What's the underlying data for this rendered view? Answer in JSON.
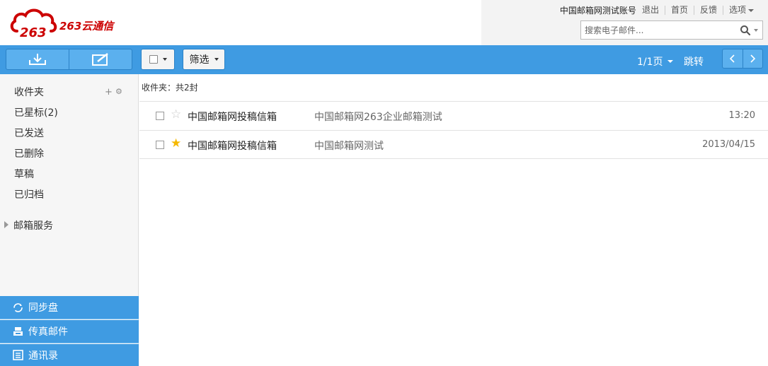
{
  "brand": {
    "logo_text": "263云通信"
  },
  "header": {
    "account": "中国邮箱网测试账号",
    "links": [
      "退出",
      "首页",
      "反馈",
      "选项"
    ],
    "search_placeholder": "搜索电子邮件..."
  },
  "toolbar": {
    "receive_icon": "download-tray-icon",
    "compose_icon": "compose-edit-icon",
    "filter_label": "筛选",
    "page_label": "1/1页",
    "jump_label": "跳转"
  },
  "sidebar": {
    "folders": [
      {
        "label": "收件夹"
      },
      {
        "label": "已星标(2)"
      },
      {
        "label": "已发送"
      },
      {
        "label": "已删除"
      },
      {
        "label": "草稿"
      },
      {
        "label": "已归档"
      }
    ],
    "mail_services": "邮箱服务",
    "bottom_nav": [
      {
        "label": "同步盘",
        "icon": "sync-icon"
      },
      {
        "label": "传真邮件",
        "icon": "fax-icon"
      },
      {
        "label": "通讯录",
        "icon": "contacts-icon"
      }
    ]
  },
  "main": {
    "folder_summary": "收件夹：共2封",
    "messages": [
      {
        "sender": "中国邮箱网投稿信箱",
        "subject": "中国邮箱网263企业邮箱测试",
        "time": "13:20",
        "starred": false
      },
      {
        "sender": "中国邮箱网投稿信箱",
        "subject": "中国邮箱网测试",
        "time": "2013/04/15",
        "starred": true
      }
    ]
  },
  "colors": {
    "toolbar_blue": "#3f9be2",
    "brand_red": "#cc0000",
    "star_gold": "#f5b800"
  }
}
